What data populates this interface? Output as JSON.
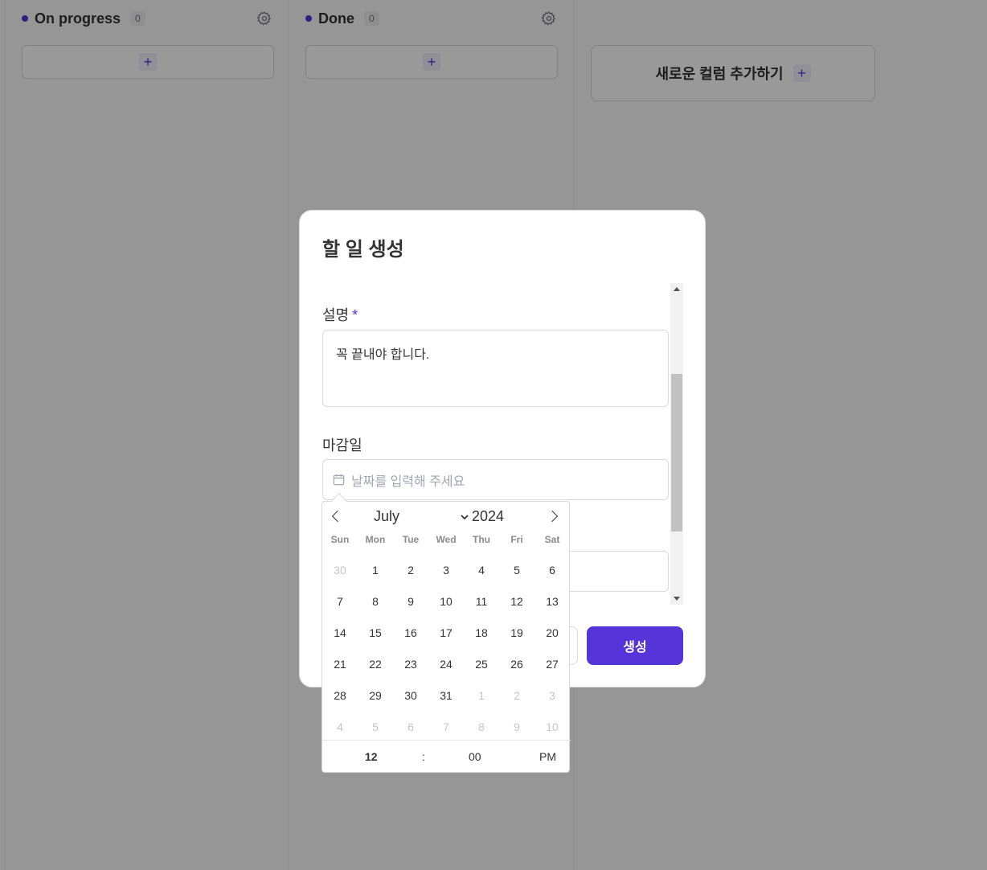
{
  "board": {
    "columns": [
      {
        "title": "On progress",
        "count": "0"
      },
      {
        "title": "Done",
        "count": "0"
      }
    ],
    "add_card_symbol": "+",
    "new_column_label": "새로운 컬럼 추가하기",
    "new_column_symbol": "+"
  },
  "modal": {
    "title": "할 일 생성",
    "description_label": "설명",
    "required_mark": "*",
    "description_value": "꼭 끝내야 합니다.",
    "due_label": "마감일",
    "due_placeholder": "날짜를 입력해 주세요",
    "create_button": "생성"
  },
  "datepicker": {
    "month": "July",
    "year": "2024",
    "weekdays": [
      "Sun",
      "Mon",
      "Tue",
      "Wed",
      "Thu",
      "Fri",
      "Sat"
    ],
    "weeks": [
      [
        "30",
        "1",
        "2",
        "3",
        "4",
        "5",
        "6"
      ],
      [
        "7",
        "8",
        "9",
        "10",
        "11",
        "12",
        "13"
      ],
      [
        "14",
        "15",
        "16",
        "17",
        "18",
        "19",
        "20"
      ],
      [
        "21",
        "22",
        "23",
        "24",
        "25",
        "26",
        "27"
      ],
      [
        "28",
        "29",
        "30",
        "31",
        "1",
        "2",
        "3"
      ],
      [
        "4",
        "5",
        "6",
        "7",
        "8",
        "9",
        "10"
      ]
    ],
    "hour": "12",
    "separator": ":",
    "minute": "00",
    "ampm": "PM"
  },
  "colors": {
    "accent": "#5534da",
    "overlay": "rgba(0,0,0,0.4)"
  },
  "icons": [
    "settings-gear-icon",
    "plus-icon",
    "calendar-icon",
    "chevron-left-icon",
    "chevron-right-icon",
    "chevron-down-icon"
  ]
}
